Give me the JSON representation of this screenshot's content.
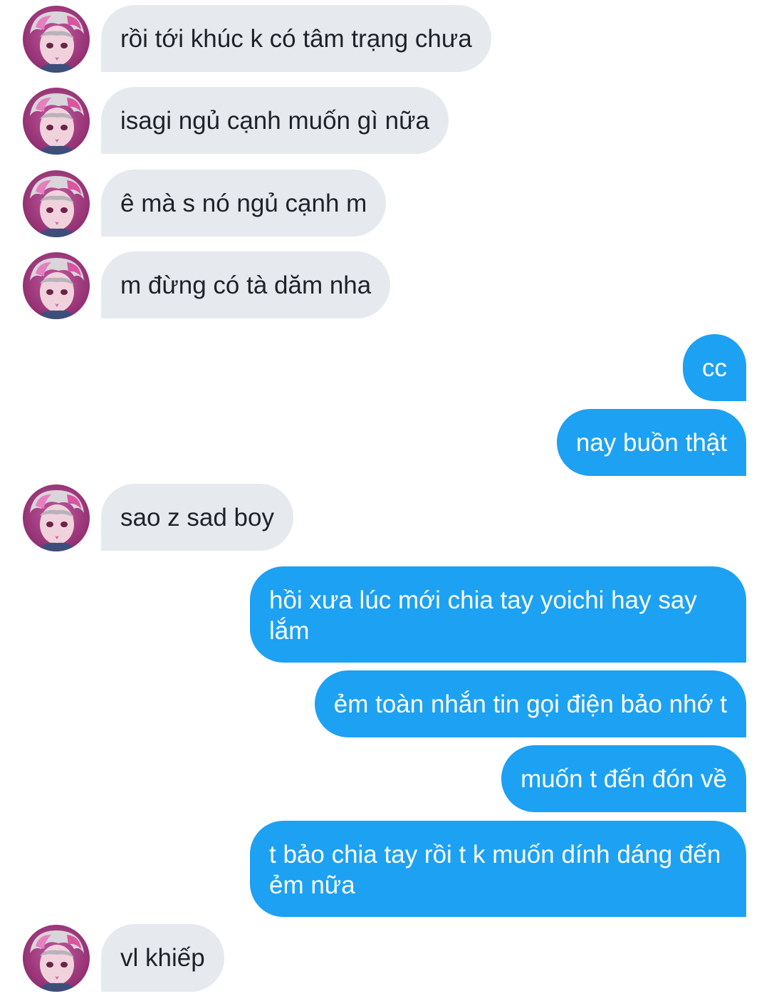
{
  "contact": {
    "avatar_icon": "user-avatar-icon"
  },
  "colors": {
    "incoming_bubble": "#e6e9ee",
    "outgoing_bubble": "#1da1f2",
    "incoming_text": "#1f2329",
    "outgoing_text": "#ffffff"
  },
  "messages": [
    {
      "direction": "incoming",
      "text": "rồi tới khúc k có tâm trạng chưa"
    },
    {
      "direction": "incoming",
      "text": "isagi ngủ cạnh muốn gì nữa"
    },
    {
      "direction": "incoming",
      "text": "ê mà s nó ngủ cạnh m"
    },
    {
      "direction": "incoming",
      "text": "m đừng có tà dăm nha"
    },
    {
      "direction": "outgoing",
      "text": "cc"
    },
    {
      "direction": "outgoing",
      "text": "nay buồn thật"
    },
    {
      "direction": "incoming",
      "text": "sao z sad boy"
    },
    {
      "direction": "outgoing",
      "text": "hồi xưa lúc mới chia tay yoichi hay say lắm"
    },
    {
      "direction": "outgoing",
      "text": "ẻm toàn nhắn tin gọi điện bảo nhớ t"
    },
    {
      "direction": "outgoing",
      "text": "muốn t đến đón về"
    },
    {
      "direction": "outgoing",
      "text": "t bảo chia tay rồi t k muốn dính dáng đến ẻm nữa"
    },
    {
      "direction": "incoming",
      "text": "vl khiếp"
    }
  ]
}
